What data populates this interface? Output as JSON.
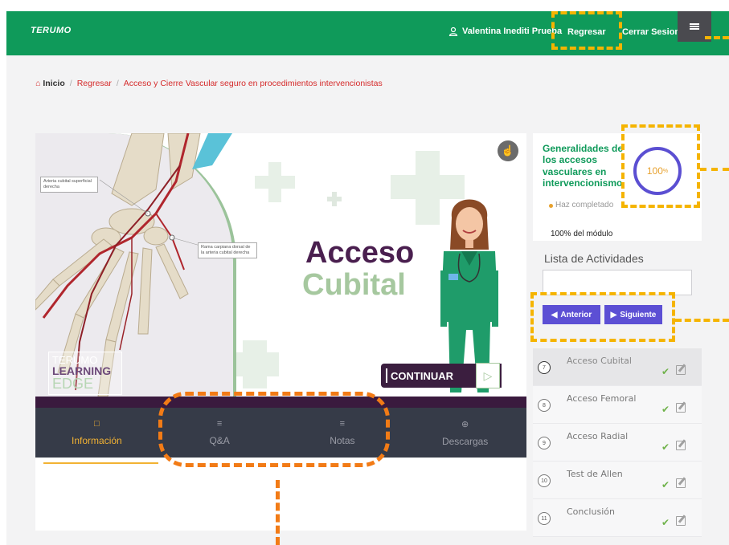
{
  "header": {
    "logo": "TERUMO",
    "user_name": "Valentina Inediti Prueba",
    "back_label": "Regresar",
    "logout_label": "Cerrar Sesion"
  },
  "breadcrumb": {
    "home": "Inicio",
    "back": "Regresar",
    "current": "Acceso y Cierre Vascular seguro en procedimientos intervencionistas"
  },
  "hero": {
    "title_line1": "Acceso",
    "title_line2": "Cubital",
    "label_artery": "Arteria cubital superficial derecha",
    "label_branch": "Rama carpiana dorsal de la arteria cubital derecha",
    "brand_line1": "TERUMO",
    "brand_line2": "LEARNING",
    "brand_line3": "EDGE",
    "continue_label": "CONTINUAR"
  },
  "tabs": [
    {
      "label": "Información",
      "icon": "document-icon",
      "active": true
    },
    {
      "label": "Q&A",
      "icon": "list-icon",
      "active": false
    },
    {
      "label": "Notas",
      "icon": "list-icon",
      "active": false
    },
    {
      "label": "Descargas",
      "icon": "download-icon",
      "active": false
    }
  ],
  "progress": {
    "module_title": "Generalidades de los accesos vasculares en intervencionismo",
    "percent": "100",
    "percent_unit": "%",
    "status_text": "Haz completado",
    "module_percent": "100% del módulo"
  },
  "activities": {
    "title": "Lista de Actividades",
    "prev_label": "Anterior",
    "next_label": "Siguiente",
    "items": [
      {
        "num": "7",
        "label": "Acceso Cubital",
        "current": true
      },
      {
        "num": "8",
        "label": "Acceso Femoral",
        "current": false
      },
      {
        "num": "9",
        "label": "Acceso Radial",
        "current": false
      },
      {
        "num": "10",
        "label": "Test de Allen",
        "current": false
      },
      {
        "num": "11",
        "label": "Conclusión",
        "current": false
      }
    ]
  },
  "colors": {
    "header_green": "#0f9a5a",
    "accent_purple": "#5c4fd4",
    "tab_active": "#f2b233",
    "annotation_yellow": "#f5b400",
    "annotation_orange": "#f27b16"
  }
}
